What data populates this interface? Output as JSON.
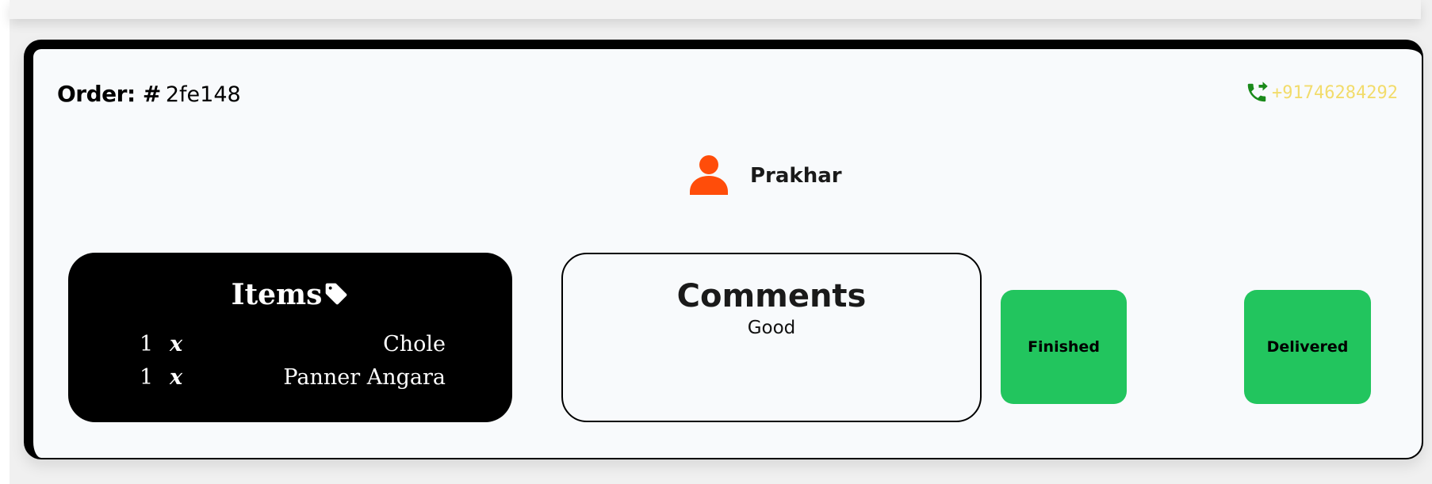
{
  "order": {
    "label": "Order: #",
    "id": "2fe148",
    "phone": "+917462842​92"
  },
  "customer": {
    "name": "Prakhar",
    "icon": "user-icon",
    "icon_color": "#ff4d0a"
  },
  "items": {
    "title": "Items",
    "icon": "tag-icon",
    "list": [
      {
        "qty": "1",
        "sep": "x",
        "name": "Chole"
      },
      {
        "qty": "1",
        "sep": "x",
        "name": "Panner Angara"
      }
    ]
  },
  "comments": {
    "title": "Comments",
    "text": "Good"
  },
  "actions": {
    "finished_label": "Finished",
    "delivered_label": "Delivered",
    "button_color": "#22c55e"
  },
  "colors": {
    "phone_icon": "#1a8a1a",
    "phone_text": "#f2dc6b"
  }
}
